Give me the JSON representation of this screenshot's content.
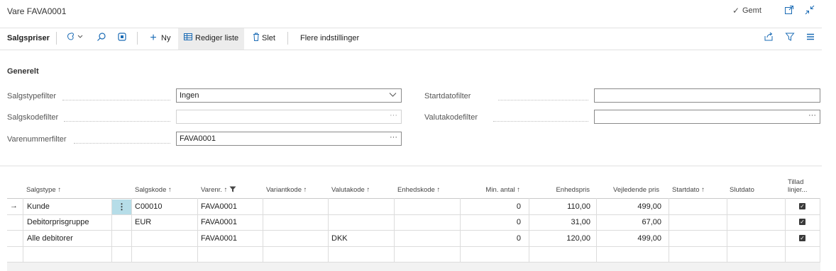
{
  "header": {
    "title": "Vare FAVA0001",
    "saved_text": "Gemt",
    "icons": [
      "checkmark-icon",
      "open-new-window-icon",
      "collapse-icon"
    ]
  },
  "toolbar": {
    "page_label": "Salgspriser",
    "new_label": "Ny",
    "edit_list_label": "Rediger liste",
    "delete_label": "Slet",
    "more_settings_label": "Flere indstillinger"
  },
  "general": {
    "section_title": "Generelt",
    "sales_type_filter_label": "Salgstypefilter",
    "sales_type_filter_value": "Ingen",
    "sales_code_filter_label": "Salgskodefilter",
    "sales_code_filter_value": "",
    "item_no_filter_label": "Varenummerfilter",
    "item_no_filter_value": "FAVA0001",
    "start_date_filter_label": "Startdatofilter",
    "start_date_filter_value": "",
    "currency_code_filter_label": "Valutakodefilter",
    "currency_code_filter_value": ""
  },
  "grid": {
    "columns": {
      "sales_type": "Salgstype",
      "sales_code": "Salgskode",
      "item_no": "Varenr.",
      "variant_code": "Variantkode",
      "currency_code": "Valutakode",
      "unit_code": "Enhedskode",
      "min_qty": "Min. antal",
      "unit_price": "Enhedspris",
      "suggested_price": "Vejledende pris",
      "start_date": "Startdato",
      "end_date": "Slutdato",
      "allow_line_1": "Tillad",
      "allow_line_2": "linjer..."
    },
    "sort_arrow": "↑",
    "row_arrow": "→",
    "rows": [
      {
        "sales_type": "Kunde",
        "sales_code": "C00010",
        "item_no": "FAVA0001",
        "variant_code": "",
        "currency_code": "",
        "unit_code": "",
        "min_qty": "0",
        "unit_price": "110,00",
        "suggested_price": "499,00",
        "start_date": "",
        "end_date": "",
        "allow": true
      },
      {
        "sales_type": "Debitorprisgruppe",
        "sales_code": "EUR",
        "item_no": "FAVA0001",
        "variant_code": "",
        "currency_code": "",
        "unit_code": "",
        "min_qty": "0",
        "unit_price": "31,00",
        "suggested_price": "67,00",
        "start_date": "",
        "end_date": "",
        "allow": true
      },
      {
        "sales_type": "Alle debitorer",
        "sales_code": "",
        "item_no": "FAVA0001",
        "variant_code": "",
        "currency_code": "DKK",
        "unit_code": "",
        "min_qty": "0",
        "unit_price": "120,00",
        "suggested_price": "499,00",
        "start_date": "",
        "end_date": "",
        "allow": true
      }
    ]
  }
}
